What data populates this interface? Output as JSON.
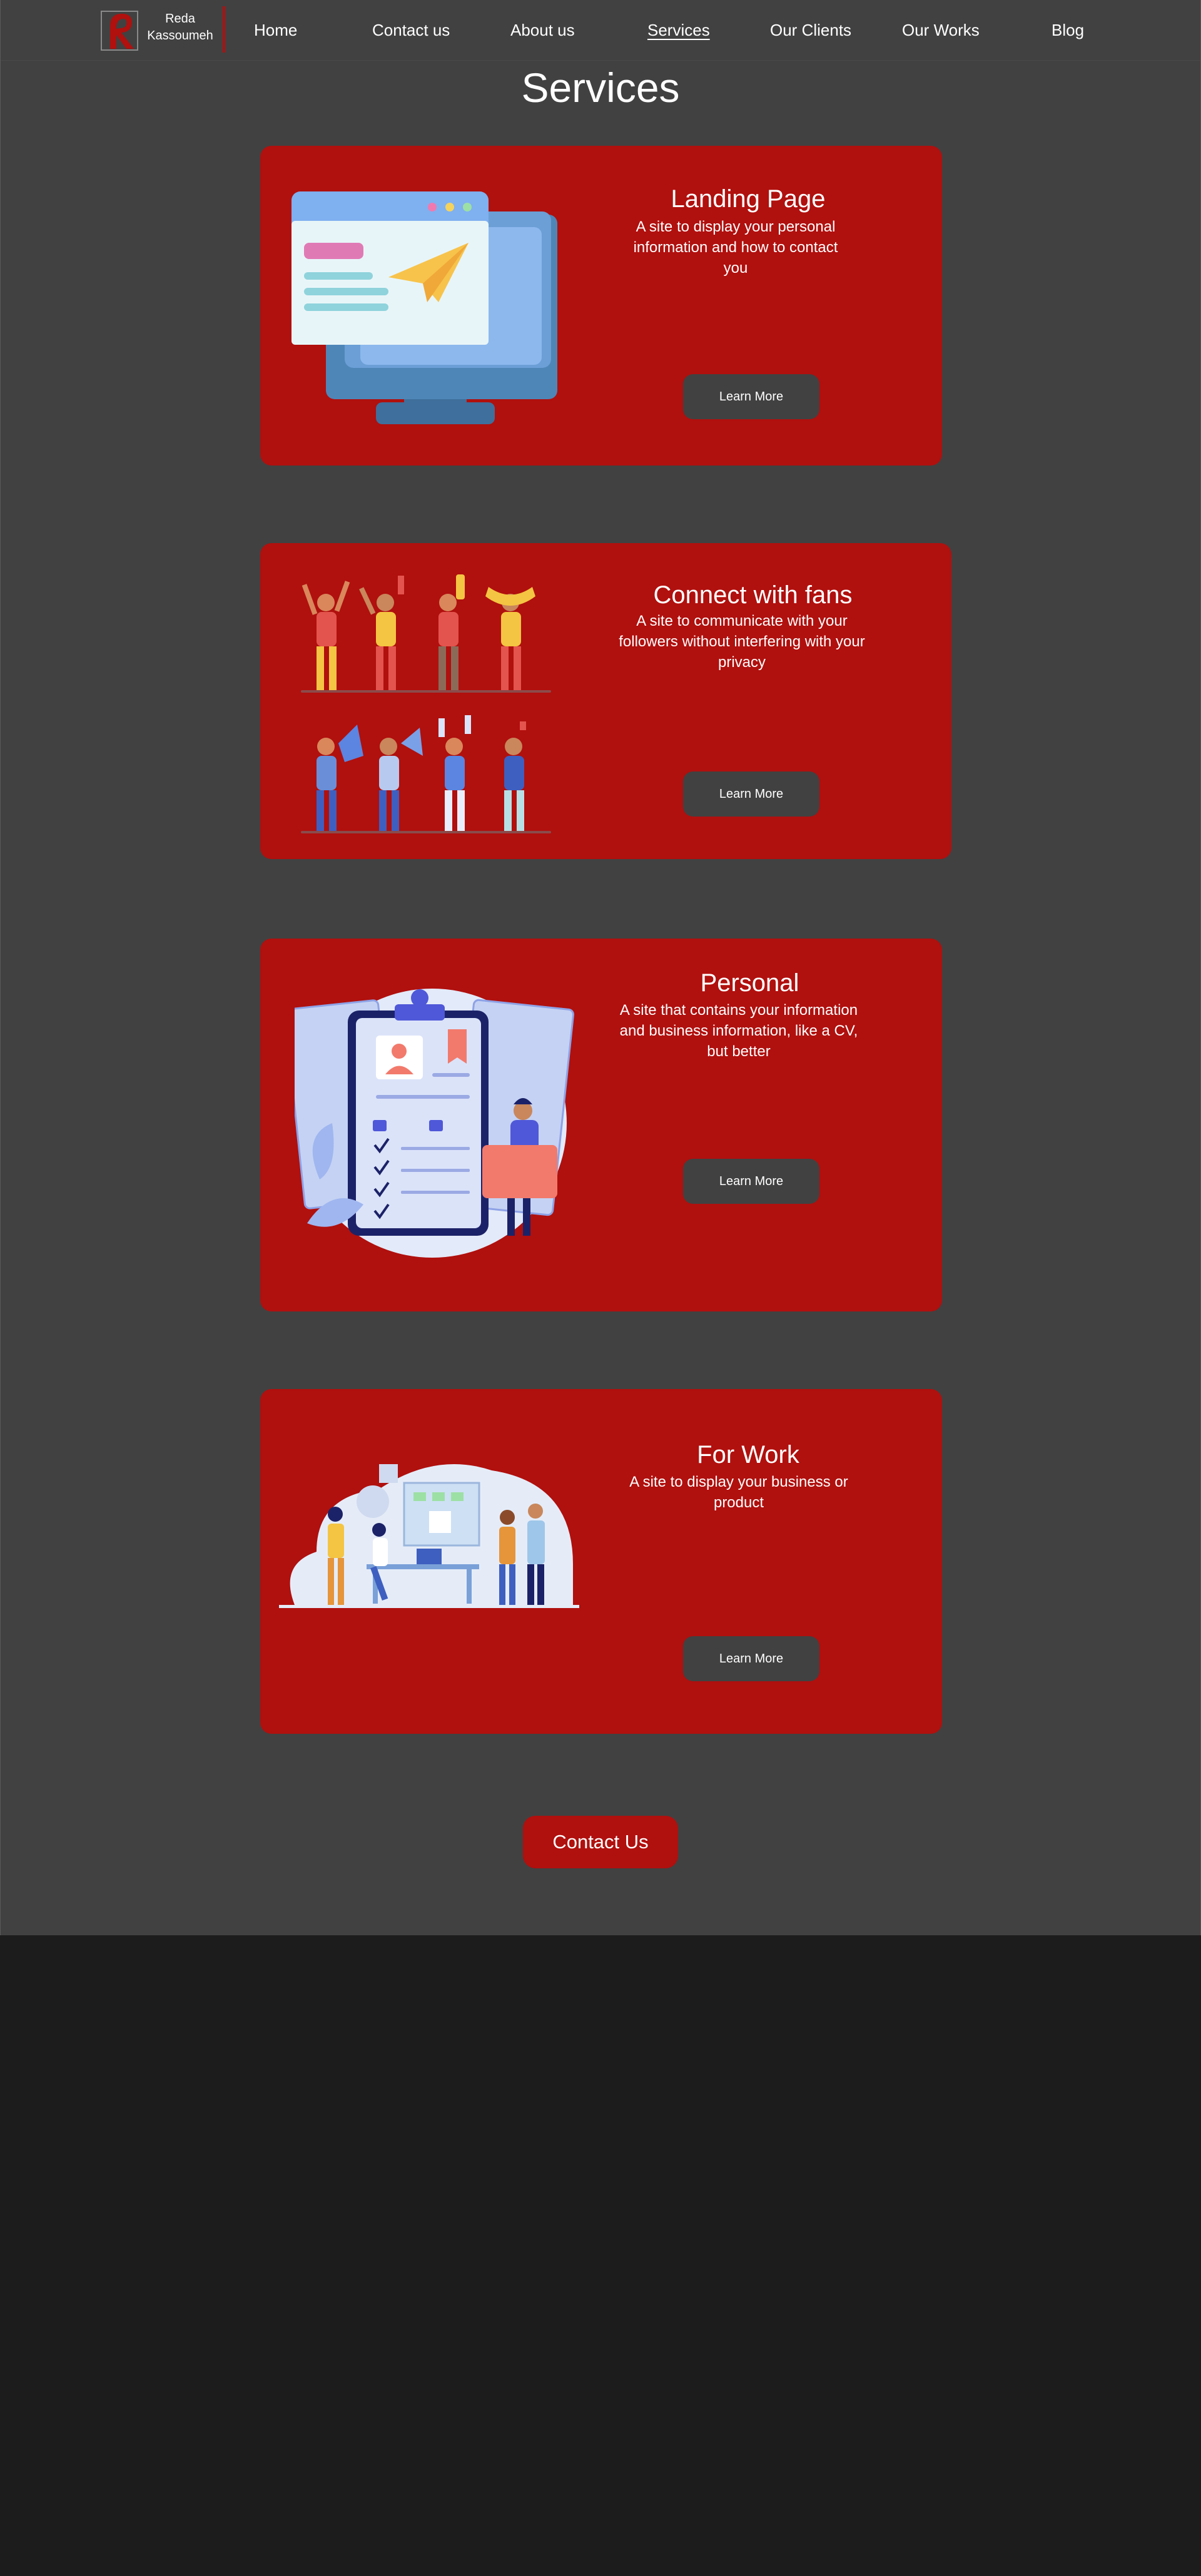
{
  "brand": {
    "line1": "Reda",
    "line2": "Kassoumeh"
  },
  "nav": {
    "home": "Home",
    "contact": "Contact us",
    "about": "About us",
    "services": "Services",
    "clients": "Our Clients",
    "works": "Our Works",
    "blog": "Blog"
  },
  "page": {
    "title": "Services"
  },
  "cards": [
    {
      "title": "Landing Page",
      "desc": "A site to display your personal information and how to contact you",
      "button": "Learn More"
    },
    {
      "title": "Connect with fans",
      "desc": "A site to communicate with your followers without interfering with your privacy",
      "button": "Learn More"
    },
    {
      "title": "Personal",
      "desc": "A site that contains your information and business information, like a CV, but better",
      "button": "Learn More"
    },
    {
      "title": "For Work",
      "desc": "A site to display your business or product",
      "button": "Learn More"
    }
  ],
  "contact_button": "Contact Us",
  "colors": {
    "accent": "#b0100e",
    "page_bg": "#414141",
    "footer_bg": "#1c1c1c"
  },
  "icons": [
    "logo-mark",
    "monitor-illustration",
    "fans-illustration",
    "clipboard-illustration",
    "team-illustration"
  ]
}
